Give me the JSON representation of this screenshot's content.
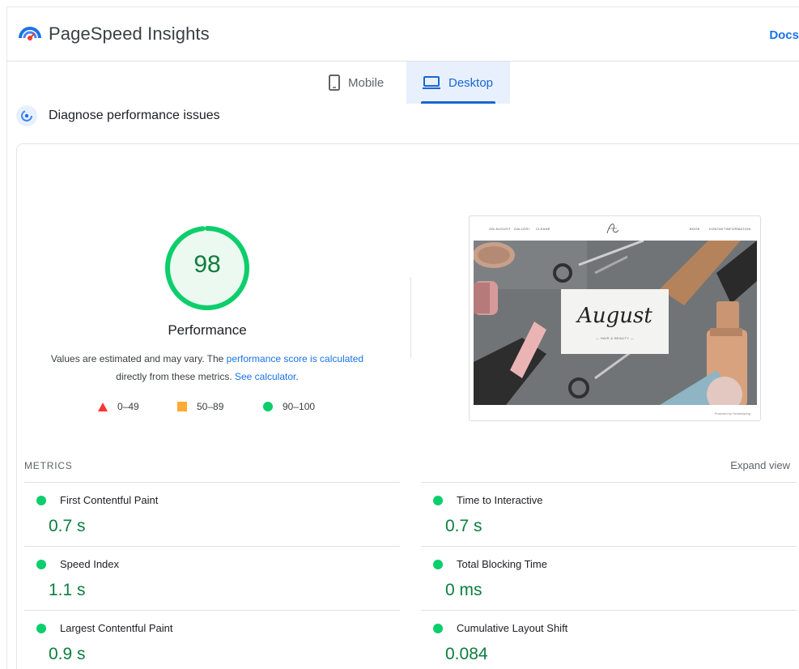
{
  "header": {
    "app_title": "PageSpeed Insights",
    "logo_icon": "pagespeed-logo-icon",
    "docs_link": "Docs"
  },
  "tabs": [
    {
      "label": "Mobile",
      "icon": "phone-icon",
      "selected": false
    },
    {
      "label": "Desktop",
      "icon": "laptop-icon",
      "selected": true
    }
  ],
  "diagnose": {
    "icon": "diagnose-gauge-icon",
    "title": "Diagnose performance issues"
  },
  "performance": {
    "score": "98",
    "score_fraction": 0.98,
    "title": "Performance",
    "note_prefix": "Values are estimated and may vary. The ",
    "note_link1": "performance score is calculated",
    "note_middle": " directly from these metrics. ",
    "note_link2": "See calculator",
    "note_suffix": ".",
    "legend": [
      {
        "label": "0–49",
        "shape": "triangle",
        "color": "#ff3333"
      },
      {
        "label": "50–89",
        "shape": "square",
        "color": "#ffaa33"
      },
      {
        "label": "90–100",
        "shape": "circle",
        "color": "#0cce6b"
      }
    ]
  },
  "screenshot": {
    "nav_left": [
      "OM AUGUST",
      "GALLERI",
      "CLEANE"
    ],
    "nav_right": [
      "BOOK",
      "KONTAKTINFORMATION"
    ],
    "brand_name": "August",
    "brand_sub": "— HAIR & BEAUTY —",
    "footer": "Powered by Ordrestyring"
  },
  "metrics": {
    "label": "METRICS",
    "expand": "Expand view",
    "items": [
      {
        "name": "First Contentful Paint",
        "value": "0.7 s"
      },
      {
        "name": "Time to Interactive",
        "value": "0.7 s"
      },
      {
        "name": "Speed Index",
        "value": "1.1 s"
      },
      {
        "name": "Total Blocking Time",
        "value": "0 ms"
      },
      {
        "name": "Largest Contentful Paint",
        "value": "0.9 s"
      },
      {
        "name": "Cumulative Layout Shift",
        "value": "0.084"
      }
    ]
  },
  "colors": {
    "accent": "#1a73e8",
    "good": "#0cce6b",
    "good_text": "#0c7d3e"
  }
}
